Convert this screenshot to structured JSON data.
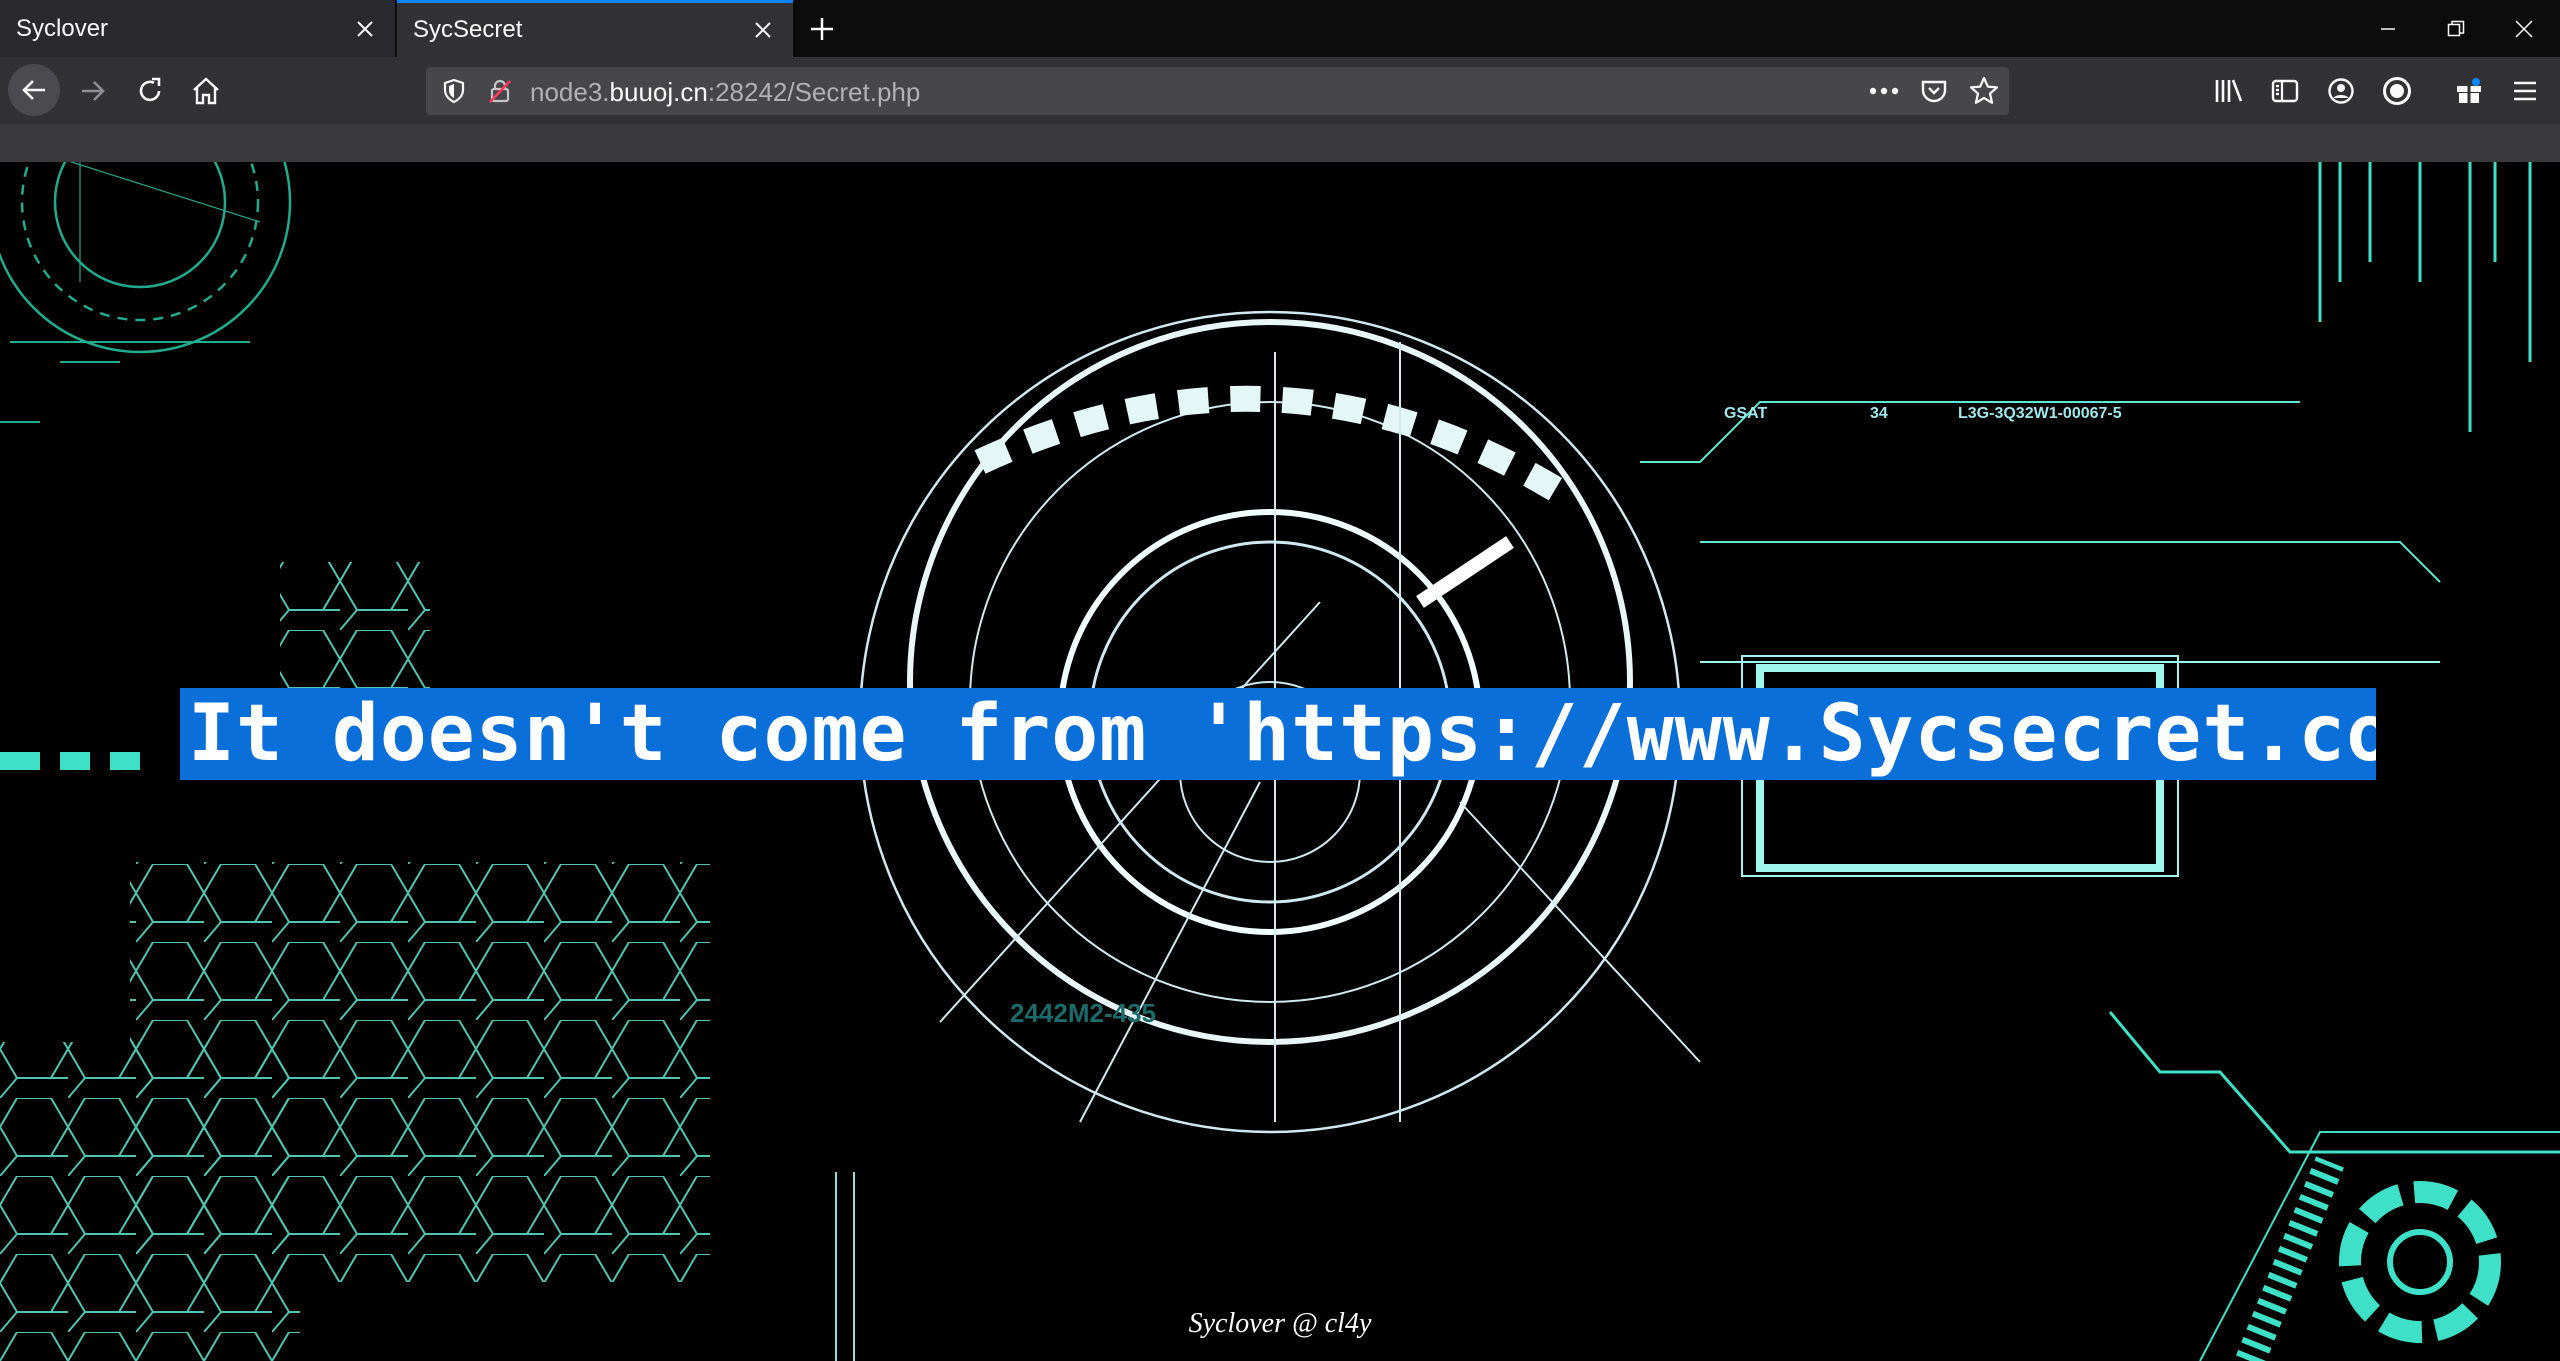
{
  "tabs": [
    {
      "title": "Syclover"
    },
    {
      "title": "SycSecret"
    }
  ],
  "urlbar": {
    "prefix": "node3.",
    "host": "buuoj.cn",
    "suffix": ":28242/Secret.php"
  },
  "icons": {
    "back": "arrow-left-icon",
    "forward": "arrow-right-icon",
    "reload": "reload-icon",
    "home": "home-icon",
    "page_actions": "more-horizontal-icon",
    "pocket": "pocket-icon",
    "bookmark": "star-icon",
    "library": "library-icon",
    "sidebar": "sidebar-icon",
    "account": "account-icon",
    "extension": "record-icon",
    "whats_new": "gift-icon",
    "menu": "hamburger-menu-icon"
  },
  "content": {
    "message": "It doesn't come from 'https://www.Sycsecret.com'",
    "footer": "Syclover @ cl4y",
    "hud_labels": {
      "gsat": "GSAT",
      "code1": "34",
      "code2": "L3G-3Q32W1-00067-5",
      "code3": "2442M2-435"
    }
  },
  "colors": {
    "tab_accent": "#0a84ff",
    "message_bg": "#0a6fd8",
    "hud_cyan": "#3fe0c8"
  }
}
